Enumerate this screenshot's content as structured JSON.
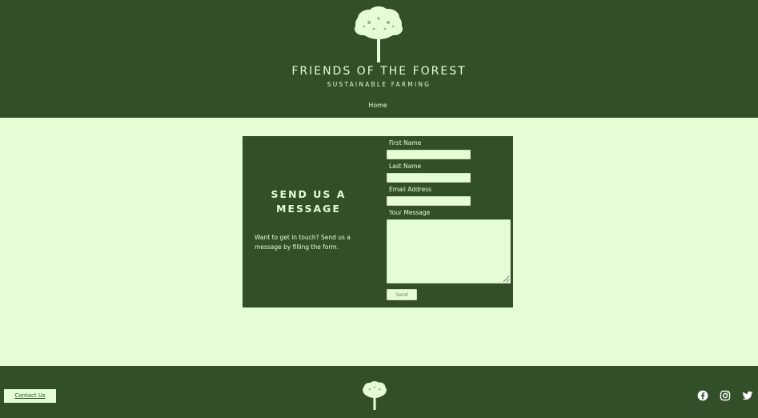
{
  "header": {
    "logo_icon": "tree-icon",
    "title": "FRIENDS OF THE FOREST",
    "subtitle": "SUSTAINABLE FARMING",
    "nav": [
      {
        "label": "Home"
      }
    ]
  },
  "contact_card": {
    "heading_line1": "SEND US A",
    "heading_line2": "MESSAGE",
    "description": "Want to get in touch? Send us a message by filling the form.",
    "fields": {
      "first_name": {
        "label": "First Name",
        "value": ""
      },
      "last_name": {
        "label": "Last Name",
        "value": ""
      },
      "email": {
        "label": "Email Address",
        "value": ""
      },
      "message": {
        "label": "Your Message",
        "value": ""
      }
    },
    "send_label": "Send"
  },
  "footer": {
    "contact_label": "Contact Us",
    "logo_icon": "tree-icon",
    "social_icons": [
      "facebook-icon",
      "instagram-icon",
      "twitter-icon"
    ]
  },
  "colors": {
    "primary_dark": "#324f2a",
    "primary_light": "#e4fdd6"
  }
}
